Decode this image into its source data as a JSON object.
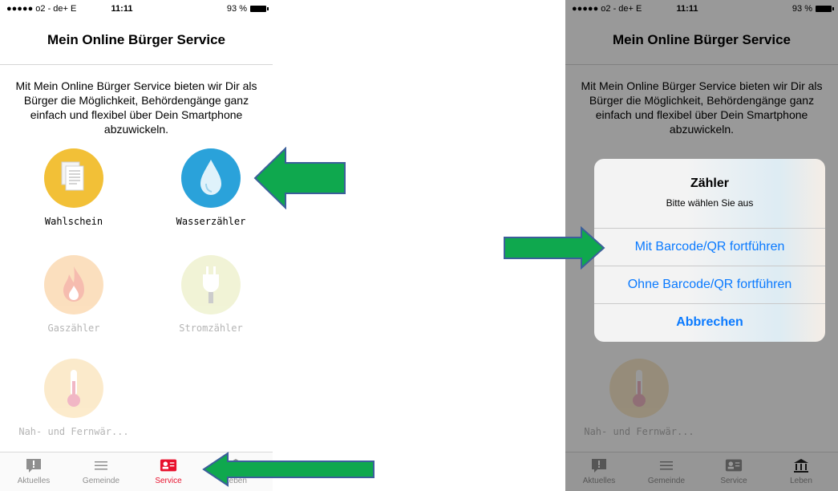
{
  "status_bar": {
    "carrier": "●●●●● o2 - de+  E",
    "time": "11:11",
    "battery": "93 %"
  },
  "nav": {
    "title": "Mein Online Bürger Service"
  },
  "intro": "Mit Mein Online Bürger Service bieten wir Dir als Bürger die Möglichkeit, Behördengänge ganz einfach und flexibel über Dein Smartphone abzuwickeln.",
  "services": [
    {
      "label": "Wahlschein",
      "icon": "document-icon",
      "color": "#f2c037",
      "enabled": true
    },
    {
      "label": "Wasserzähler",
      "icon": "water-drop-icon",
      "color": "#2aa2da",
      "enabled": true
    },
    {
      "label": "Gaszähler",
      "icon": "flame-icon",
      "color": "#f5a548",
      "enabled": false
    },
    {
      "label": "Stromzähler",
      "icon": "plug-icon",
      "color": "#d8df8b",
      "enabled": false
    },
    {
      "label": "Nah- und Fernwär...",
      "icon": "thermometer-icon",
      "color": "#f6c66c",
      "enabled": false
    }
  ],
  "tabs": [
    {
      "label": "Aktuelles",
      "icon": "exclamation-icon"
    },
    {
      "label": "Gemeinde",
      "icon": "list-icon"
    },
    {
      "label": "Service",
      "icon": "id-card-icon",
      "active": true
    },
    {
      "label": "Leben",
      "icon": "bank-icon"
    }
  ],
  "alert": {
    "title": "Zähler",
    "message": "Bitte wählen Sie aus",
    "buttons": [
      "Mit Barcode/QR fortführen",
      "Ohne Barcode/QR fortführen",
      "Abbrechen"
    ]
  },
  "colors": {
    "accent_red": "#e8112d",
    "ios_blue": "#0a7aff",
    "arrow_green": "#0fa84e"
  }
}
